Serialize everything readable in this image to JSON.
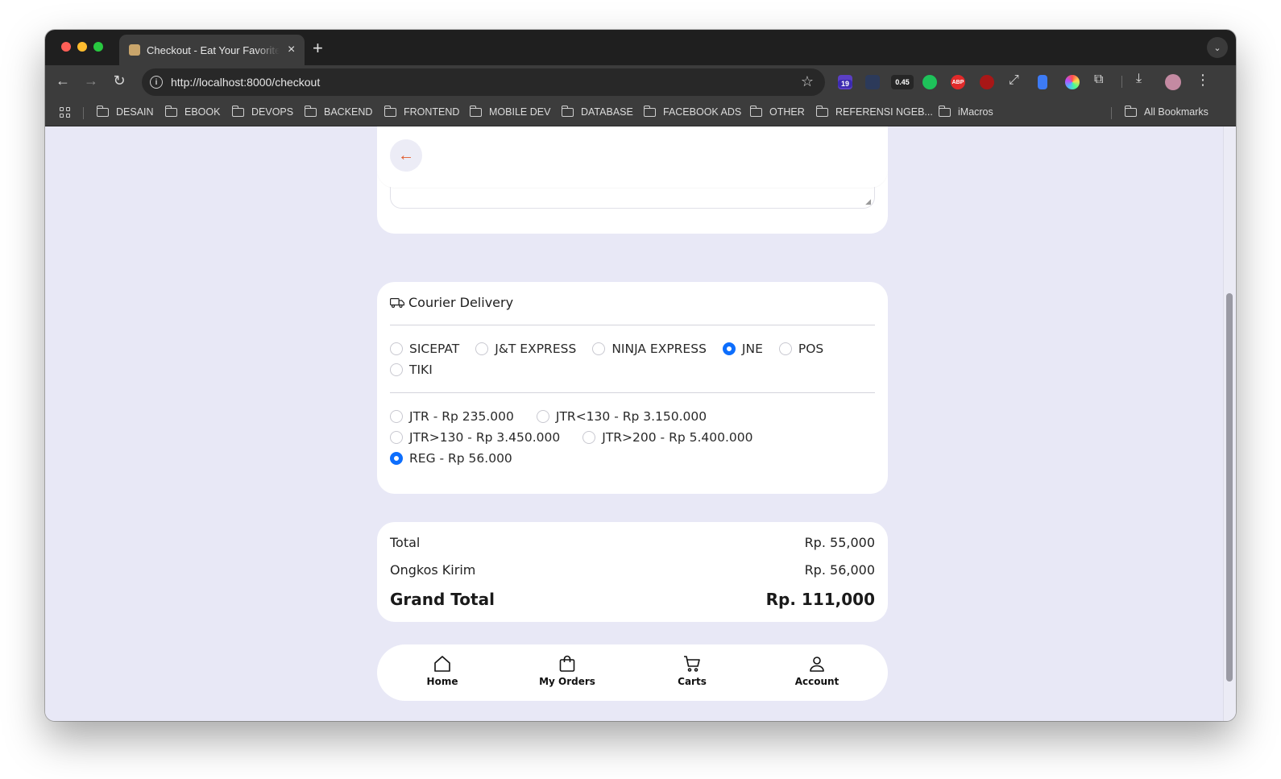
{
  "browser": {
    "tab_title": "Checkout - Eat Your Favorite Food",
    "url": "http://localhost:8000/checkout",
    "extension_badges": {
      "badge_count": "19",
      "speed": "0.45",
      "abp": "ABP"
    },
    "bookmarks": [
      "DESAIN",
      "EBOOK",
      "DEVOPS",
      "BACKEND",
      "FRONTEND",
      "MOBILE DEV",
      "DATABASE",
      "FACEBOOK ADS",
      "OTHER",
      "REFERENSI NGEB...",
      "iMacros"
    ],
    "all_bookmarks_label": "All Bookmarks"
  },
  "page": {
    "back_icon": "arrow-left-icon",
    "courier": {
      "title": "Courier Delivery",
      "icon": "truck-icon",
      "couriers": [
        {
          "label": "SICEPAT",
          "checked": false
        },
        {
          "label": "J&T EXPRESS",
          "checked": false
        },
        {
          "label": "NINJA EXPRESS",
          "checked": false
        },
        {
          "label": "JNE",
          "checked": true
        },
        {
          "label": "POS",
          "checked": false
        },
        {
          "label": "TIKI",
          "checked": false
        }
      ],
      "services": [
        {
          "label": "JTR - Rp 235.000",
          "checked": false
        },
        {
          "label": "JTR<130 - Rp 3.150.000",
          "checked": false
        },
        {
          "label": "JTR>130 - Rp 3.450.000",
          "checked": false
        },
        {
          "label": "JTR>200 - Rp 5.400.000",
          "checked": false
        },
        {
          "label": "REG - Rp 56.000",
          "checked": true
        }
      ]
    },
    "totals": {
      "total_label": "Total",
      "total_value": "Rp. 55,000",
      "shipping_label": "Ongkos Kirim",
      "shipping_value": "Rp. 56,000",
      "grand_label": "Grand Total",
      "grand_value": "Rp. 111,000"
    },
    "bottom_nav": [
      {
        "label": "Home",
        "icon": "home-icon"
      },
      {
        "label": "My Orders",
        "icon": "bag-icon"
      },
      {
        "label": "Carts",
        "icon": "cart-icon"
      },
      {
        "label": "Account",
        "icon": "user-icon"
      }
    ]
  },
  "colors": {
    "page_bg": "#e8e8f6",
    "radio_checked": "#0d6efd",
    "back_arrow": "#e15a2b"
  }
}
